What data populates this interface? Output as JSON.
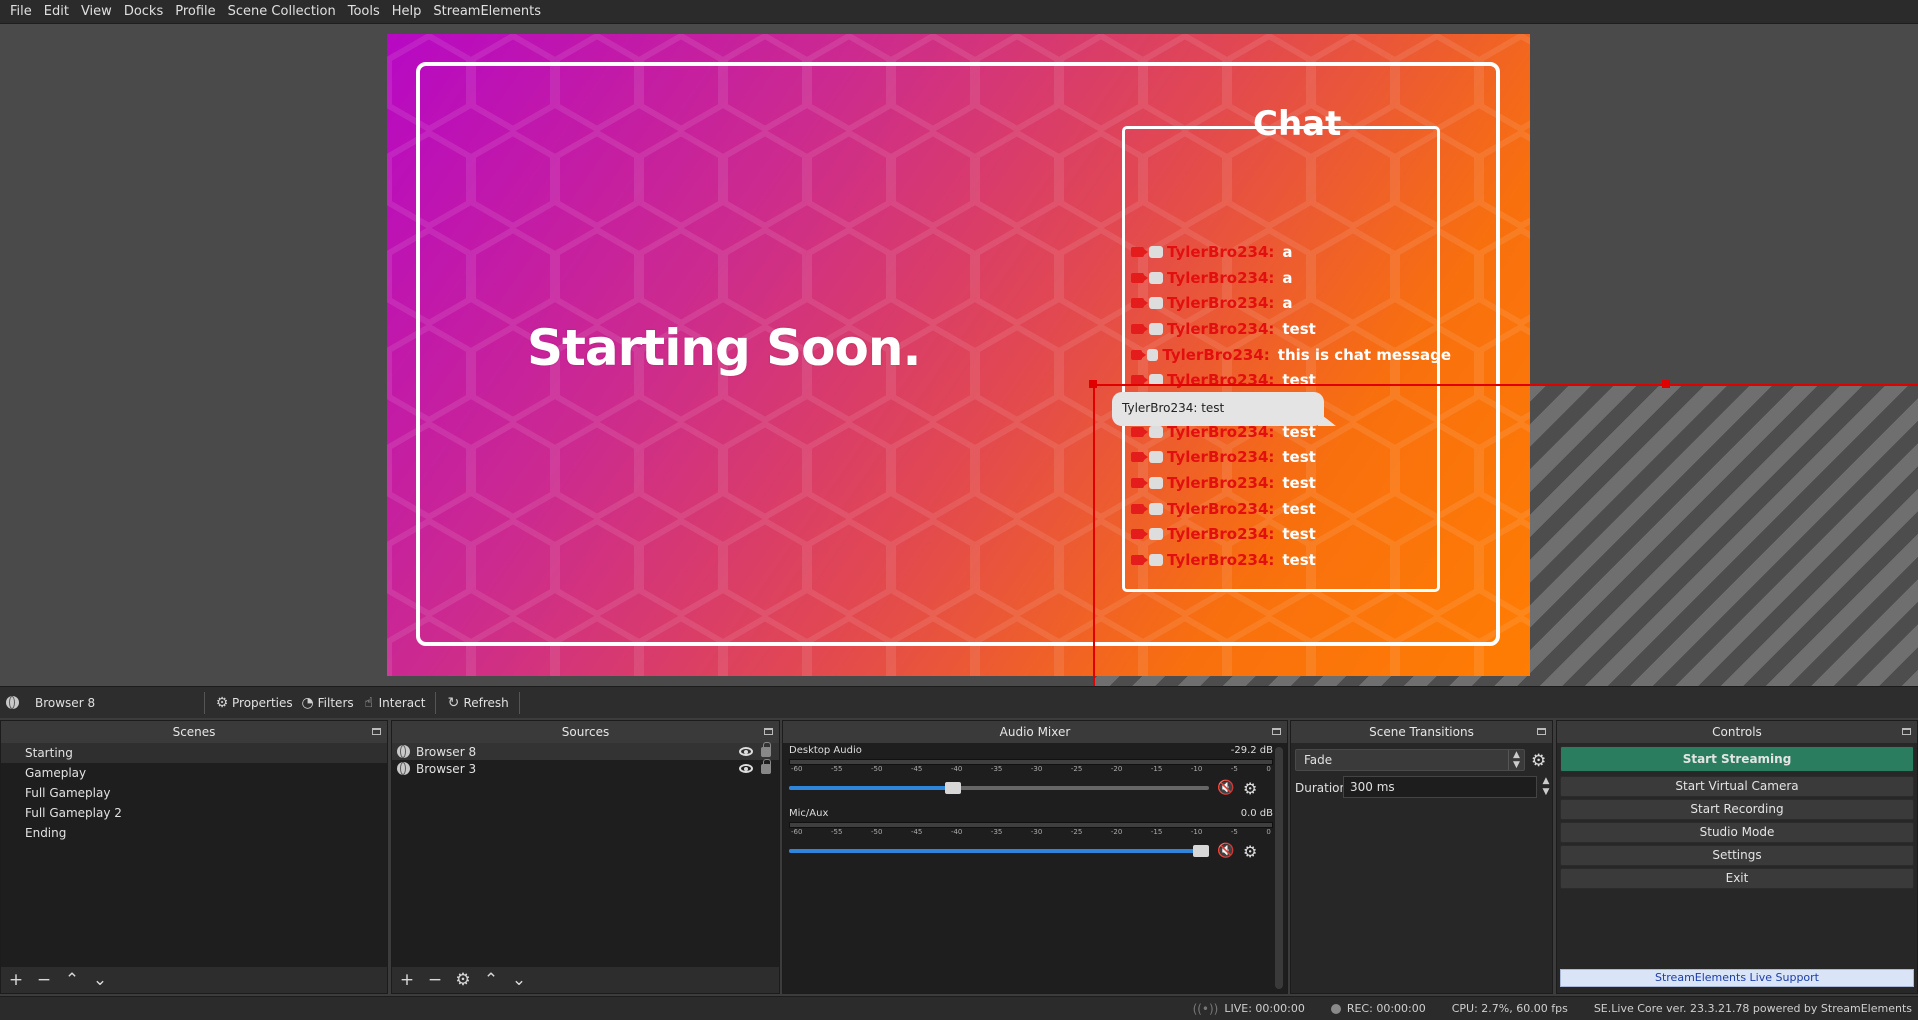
{
  "menu": [
    "File",
    "Edit",
    "View",
    "Docks",
    "Profile",
    "Scene Collection",
    "Tools",
    "Help",
    "StreamElements"
  ],
  "preview": {
    "starting_text": "Starting Soon.",
    "chat_title": "Chat",
    "messages": [
      {
        "user": "TylerBro234:",
        "text": "a"
      },
      {
        "user": "TylerBro234:",
        "text": "a"
      },
      {
        "user": "TylerBro234:",
        "text": "a"
      },
      {
        "user": "TylerBro234:",
        "text": "test"
      },
      {
        "user": "TylerBro234:",
        "text": "this is chat message"
      },
      {
        "user": "TylerBro234:",
        "text": "test"
      },
      {
        "user": "",
        "text": "test"
      },
      {
        "user": "TylerBro234:",
        "text": "test"
      },
      {
        "user": "TylerBro234:",
        "text": "test"
      },
      {
        "user": "TylerBro234:",
        "text": "test"
      },
      {
        "user": "TylerBro234:",
        "text": "test"
      },
      {
        "user": "TylerBro234:",
        "text": "test"
      },
      {
        "user": "TylerBro234:",
        "text": "test"
      }
    ],
    "bubble": "TylerBro234: test"
  },
  "source_toolbar": {
    "selected": "Browser 8",
    "properties": "Properties",
    "filters": "Filters",
    "interact": "Interact",
    "refresh": "Refresh"
  },
  "scenes": {
    "title": "Scenes",
    "items": [
      "Starting",
      "Gameplay",
      "Full Gameplay",
      "Full Gameplay 2",
      "Ending"
    ]
  },
  "sources": {
    "title": "Sources",
    "items": [
      "Browser 8",
      "Browser 3"
    ]
  },
  "mixer": {
    "title": "Audio Mixer",
    "channels": [
      {
        "name": "Desktop Audio",
        "db": "-29.2 dB",
        "level": 0.39
      },
      {
        "name": "Mic/Aux",
        "db": "0.0 dB",
        "level": 1.0
      }
    ],
    "ticks": [
      "-60",
      "-55",
      "-50",
      "-45",
      "-40",
      "-35",
      "-30",
      "-25",
      "-20",
      "-15",
      "-10",
      "-5",
      "0"
    ]
  },
  "transitions": {
    "title": "Scene Transitions",
    "selected": "Fade",
    "duration_label": "Duration",
    "duration": "300 ms"
  },
  "controls": {
    "title": "Controls",
    "start_streaming": "Start Streaming",
    "start_virtual_camera": "Start Virtual Camera",
    "start_recording": "Start Recording",
    "studio_mode": "Studio Mode",
    "settings": "Settings",
    "exit": "Exit",
    "support": "StreamElements Live Support"
  },
  "status": {
    "live": "LIVE: 00:00:00",
    "rec": "REC: 00:00:00",
    "cpu": "CPU: 2.7%, 60.00 fps",
    "version": "SE.Live Core ver. 23.3.21.78 powered by StreamElements"
  },
  "colors": {
    "accent_green": "#2b7d5f",
    "selection_red": "#e00000",
    "chat_user_red": "#e30f0f",
    "fader_blue": "#2e85d9"
  }
}
